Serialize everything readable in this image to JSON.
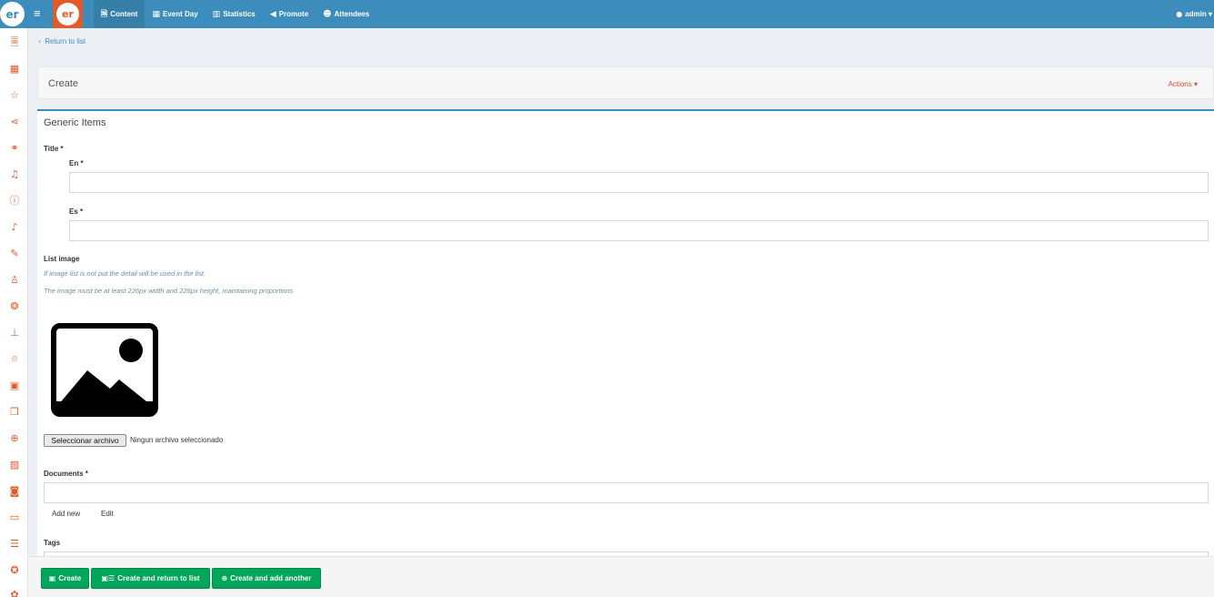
{
  "topbar": {
    "brand_text": "er",
    "logo_text": "er",
    "menu_icon": "hamburger-icon",
    "nav": [
      {
        "label": "Content",
        "icon": "file-icon"
      },
      {
        "label": "Event Day",
        "icon": "calendar-icon"
      },
      {
        "label": "Statistics",
        "icon": "bar-chart-icon"
      },
      {
        "label": "Promote",
        "icon": "bullhorn-icon"
      },
      {
        "label": "Attendees",
        "icon": "users-icon"
      }
    ],
    "user": "admin"
  },
  "sidebar": {
    "icons": [
      "document-icon",
      "calendar-icon",
      "star-icon",
      "share-icon",
      "handshake-icon",
      "bell-icon",
      "info-icon",
      "microphone-icon",
      "chat-icon",
      "user-icon",
      "comments-icon",
      "stand-icon",
      "map-marker-icon",
      "image-gallery-icon",
      "copy-icon",
      "search-icon",
      "image-icon",
      "camera-icon",
      "video-icon",
      "list-icon",
      "award-icon",
      "puzzle-icon"
    ]
  },
  "breadcrumb": {
    "back_label": "Return to list"
  },
  "header": {
    "title": "Create",
    "actions_label": "Actions"
  },
  "form": {
    "box_title": "Generic Items",
    "title_label": "Title *",
    "en_label": "En *",
    "en_value": "",
    "es_label": "Es *",
    "es_value": "",
    "list_image_label": "List image",
    "help1": "If image list is not put the detail will be used in the list.",
    "help2": "The image must be at least 226px width and 226px height, maintaining proportions",
    "file_button": "Seleccionar archivo",
    "file_status": "Ningun archivo seleccionado",
    "documents_label": "Documents *",
    "documents_value": "",
    "add_new": "Add new",
    "edit": "Edit",
    "tags_label": "Tags"
  },
  "footer": {
    "create": "Create",
    "create_return": "Create and return to list",
    "create_another": "Create and add another"
  },
  "colors": {
    "primary": "#3c8dbc",
    "accent": "#e25a28",
    "success": "#00a65a",
    "danger": "#dd4b39"
  }
}
